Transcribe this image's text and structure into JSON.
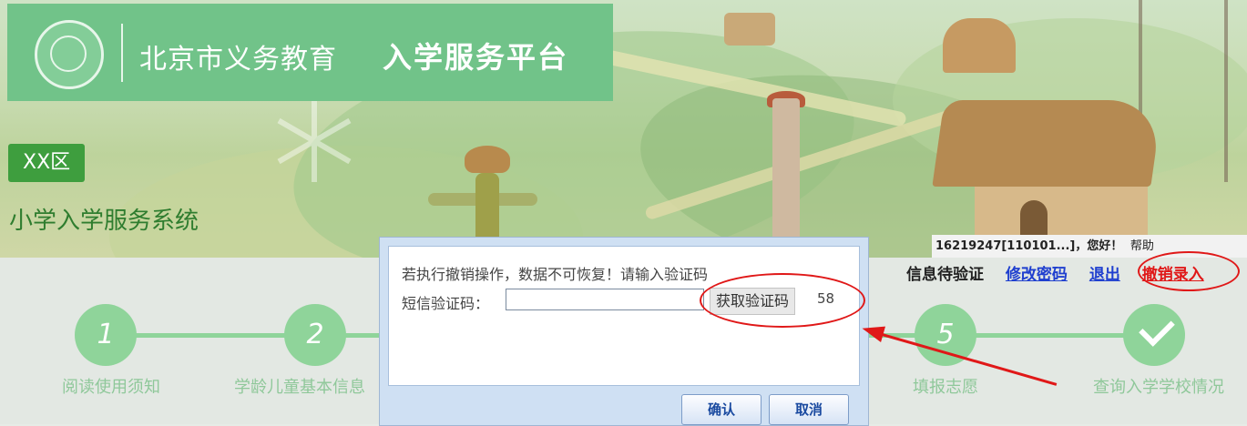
{
  "header": {
    "title_part1": "北京市义务教育",
    "title_part2": "入学服务平台",
    "district": "XX区",
    "system_name": "小学入学服务系统"
  },
  "userbar": {
    "user_id": "16219247[110101...]",
    "greeting": "，您好！",
    "help": "帮助"
  },
  "nav": {
    "status": "信息待验证",
    "change_password": "修改密码",
    "logout": "退出",
    "cancel_entry": "撤销录入"
  },
  "steps": [
    {
      "number": "1",
      "label": "阅读使用须知"
    },
    {
      "number": "2",
      "label": "学龄儿童基本信息"
    },
    {
      "number": "5",
      "label": "填报志愿"
    },
    {
      "number": "",
      "label": "查询入学学校情况"
    }
  ],
  "dialog": {
    "message": "若执行撤销操作，数据不可恢复！请输入验证码",
    "sms_label": "短信验证码：",
    "sms_value": "",
    "get_code_label": "获取验证码",
    "countdown": "58",
    "ok_label": "确认",
    "cancel_label": "取消"
  },
  "colors": {
    "accent_green": "#71c389",
    "step_green": "#8fd49a",
    "link_blue": "#1f3fcf",
    "annotation_red": "#e01818"
  }
}
